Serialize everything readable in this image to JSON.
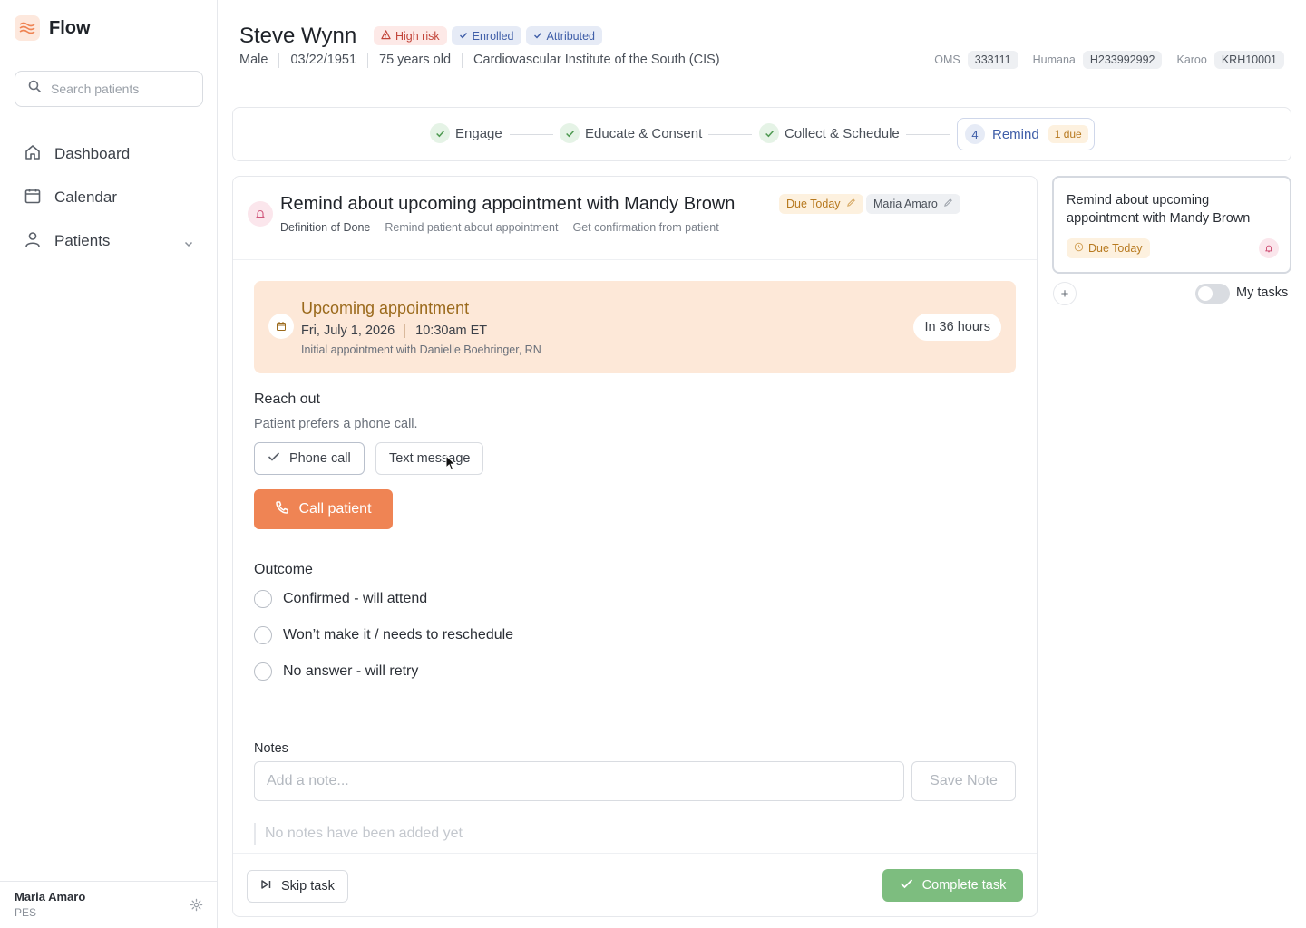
{
  "app": {
    "name": "Flow"
  },
  "sidebar": {
    "search_placeholder": "Search patients",
    "nav": [
      {
        "label": "Dashboard",
        "icon": "home-icon"
      },
      {
        "label": "Calendar",
        "icon": "calendar-icon"
      },
      {
        "label": "Patients",
        "icon": "user-icon"
      }
    ],
    "user": {
      "name": "Maria Amaro",
      "role": "PES"
    }
  },
  "patient": {
    "name": "Steve Wynn",
    "badges": {
      "risk": "High risk",
      "enrolled": "Enrolled",
      "attributed": "Attributed"
    },
    "sex": "Male",
    "dob": "03/22/1951",
    "age": "75 years old",
    "practice": "Cardiovascular Institute of the South (CIS)",
    "ids": [
      {
        "label": "OMS",
        "value": "333111"
      },
      {
        "label": "Humana",
        "value": "H233992992"
      },
      {
        "label": "Karoo",
        "value": "KRH10001"
      }
    ]
  },
  "stepper": {
    "steps": [
      "Engage",
      "Educate & Consent",
      "Collect & Schedule"
    ],
    "active": {
      "number": "4",
      "label": "Remind",
      "due": "1 due"
    }
  },
  "task": {
    "title": "Remind about upcoming appointment with Mandy Brown",
    "due": "Due Today",
    "owner": "Maria Amaro",
    "dod_label": "Definition of Done",
    "dod_items": [
      "Remind patient about appointment",
      "Get confirmation from patient"
    ],
    "appointment": {
      "title": "Upcoming appointment",
      "date": "Fri, July 1, 2026",
      "time": "10:30am ET",
      "description": "Initial appointment with Danielle Boehringer, RN",
      "in": "In 36 hours"
    },
    "reach_out": {
      "label": "Reach out",
      "preference": "Patient prefers a phone call.",
      "options": [
        "Phone call",
        "Text message"
      ],
      "call_button": "Call patient"
    },
    "outcome": {
      "label": "Outcome",
      "options": [
        "Confirmed - will attend",
        "Won’t make it / needs to reschedule",
        "No answer - will retry"
      ]
    },
    "notes": {
      "label": "Notes",
      "placeholder": "Add a note...",
      "save": "Save Note",
      "empty": "No notes have been added yet"
    },
    "skip": "Skip task",
    "complete": "Complete task"
  },
  "panel": {
    "task_title": "Remind about upcoming appointment with Mandy Brown",
    "task_due": "Due Today",
    "add": "+",
    "toggle_label": "My tasks"
  },
  "colors": {
    "accent": "#ef8454",
    "complete": "#7dbd7f",
    "appointment_bg": "#fde8d8",
    "due_text": "#b7791f",
    "risk": "#c2453a",
    "badge_blue": "#3f5ea8"
  }
}
